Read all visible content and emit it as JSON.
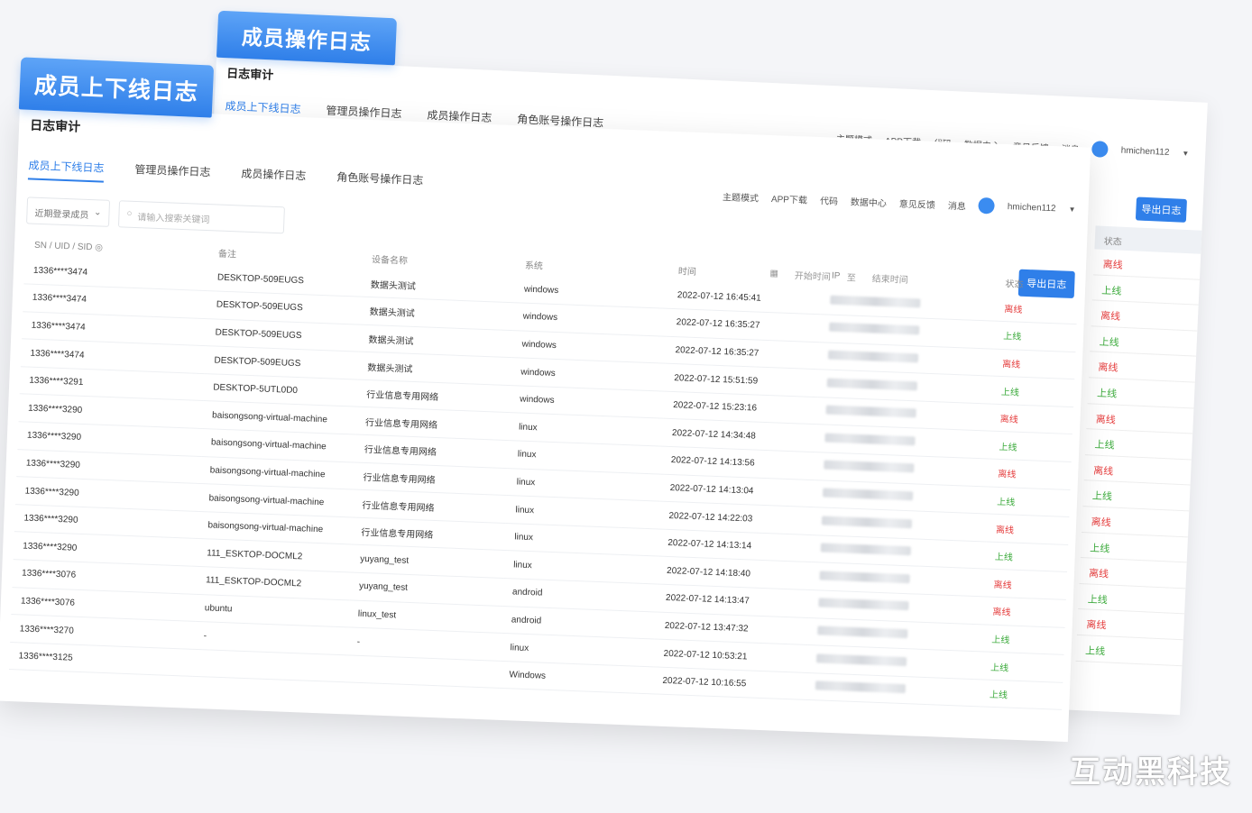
{
  "badges": {
    "back": "成员操作日志",
    "front": "成员上下线日志"
  },
  "back_window": {
    "title": "日志审计",
    "tabs": [
      "成员上下线日志",
      "管理员操作日志",
      "成员操作日志",
      "角色账号操作日志"
    ],
    "top_right": [
      "主题模式",
      "APP下载",
      "代码",
      "数据中心",
      "意见反馈",
      "消息"
    ],
    "username": "hmichen112",
    "export_label": "导出日志",
    "status_header": "状态",
    "status": [
      "离线",
      "上线",
      "离线",
      "上线",
      "离线",
      "上线",
      "离线",
      "上线",
      "离线",
      "上线",
      "离线",
      "上线",
      "离线",
      "上线",
      "离线",
      "上线"
    ]
  },
  "front_window": {
    "title": "日志审计",
    "tabs": [
      "成员上下线日志",
      "管理员操作日志",
      "成员操作日志",
      "角色账号操作日志"
    ],
    "top_right": [
      "主题模式",
      "APP下载",
      "代码",
      "数据中心",
      "意见反馈",
      "消息"
    ],
    "username": "hmichen112",
    "filter_select": "近期登录成员",
    "search_placeholder": "请输入搜索关键词",
    "date_start": "开始时间",
    "date_sep": "至",
    "date_end": "结束时间",
    "export_label": "导出日志",
    "columns": [
      "SN / UID / SID",
      "备注",
      "设备名称",
      "系统",
      "时间",
      "IP",
      "状态"
    ],
    "rows": [
      {
        "sn": "1336****3474",
        "note": "DESKTOP-509EUGS",
        "device": "数据头测试",
        "sys": "windows",
        "time": "2022-07-12 16:45:41",
        "status": "离线"
      },
      {
        "sn": "1336****3474",
        "note": "DESKTOP-509EUGS",
        "device": "数据头测试",
        "sys": "windows",
        "time": "2022-07-12 16:35:27",
        "status": "上线"
      },
      {
        "sn": "1336****3474",
        "note": "DESKTOP-509EUGS",
        "device": "数据头测试",
        "sys": "windows",
        "time": "2022-07-12 16:35:27",
        "status": "离线"
      },
      {
        "sn": "1336****3474",
        "note": "DESKTOP-509EUGS",
        "device": "数据头测试",
        "sys": "windows",
        "time": "2022-07-12 15:51:59",
        "status": "上线"
      },
      {
        "sn": "1336****3291",
        "note": "DESKTOP-5UTL0D0",
        "device": "行业信息专用网络",
        "sys": "windows",
        "time": "2022-07-12 15:23:16",
        "status": "离线"
      },
      {
        "sn": "1336****3290",
        "note": "baisongsong-virtual-machine",
        "device": "行业信息专用网络",
        "sys": "linux",
        "time": "2022-07-12 14:34:48",
        "status": "上线"
      },
      {
        "sn": "1336****3290",
        "note": "baisongsong-virtual-machine",
        "device": "行业信息专用网络",
        "sys": "linux",
        "time": "2022-07-12 14:13:56",
        "status": "离线"
      },
      {
        "sn": "1336****3290",
        "note": "baisongsong-virtual-machine",
        "device": "行业信息专用网络",
        "sys": "linux",
        "time": "2022-07-12 14:13:04",
        "status": "上线"
      },
      {
        "sn": "1336****3290",
        "note": "baisongsong-virtual-machine",
        "device": "行业信息专用网络",
        "sys": "linux",
        "time": "2022-07-12 14:22:03",
        "status": "离线"
      },
      {
        "sn": "1336****3290",
        "note": "baisongsong-virtual-machine",
        "device": "行业信息专用网络",
        "sys": "linux",
        "time": "2022-07-12 14:13:14",
        "status": "上线"
      },
      {
        "sn": "1336****3290",
        "note": "111_ESKTOP-DOCML2",
        "device": "yuyang_test",
        "sys": "linux",
        "time": "2022-07-12 14:18:40",
        "status": "离线"
      },
      {
        "sn": "1336****3076",
        "note": "111_ESKTOP-DOCML2",
        "device": "yuyang_test",
        "sys": "android",
        "time": "2022-07-12 14:13:47",
        "status": "离线"
      },
      {
        "sn": "1336****3076",
        "note": "ubuntu",
        "device": "linux_test",
        "sys": "android",
        "time": "2022-07-12 13:47:32",
        "status": "上线"
      },
      {
        "sn": "1336****3270",
        "note": "-",
        "device": "-",
        "sys": "linux",
        "time": "2022-07-12 10:53:21",
        "status": "上线"
      },
      {
        "sn": "1336****3125",
        "note": "",
        "device": "",
        "sys": "Windows",
        "time": "2022-07-12 10:16:55",
        "status": "上线"
      }
    ]
  },
  "watermark": "互动黑科技"
}
